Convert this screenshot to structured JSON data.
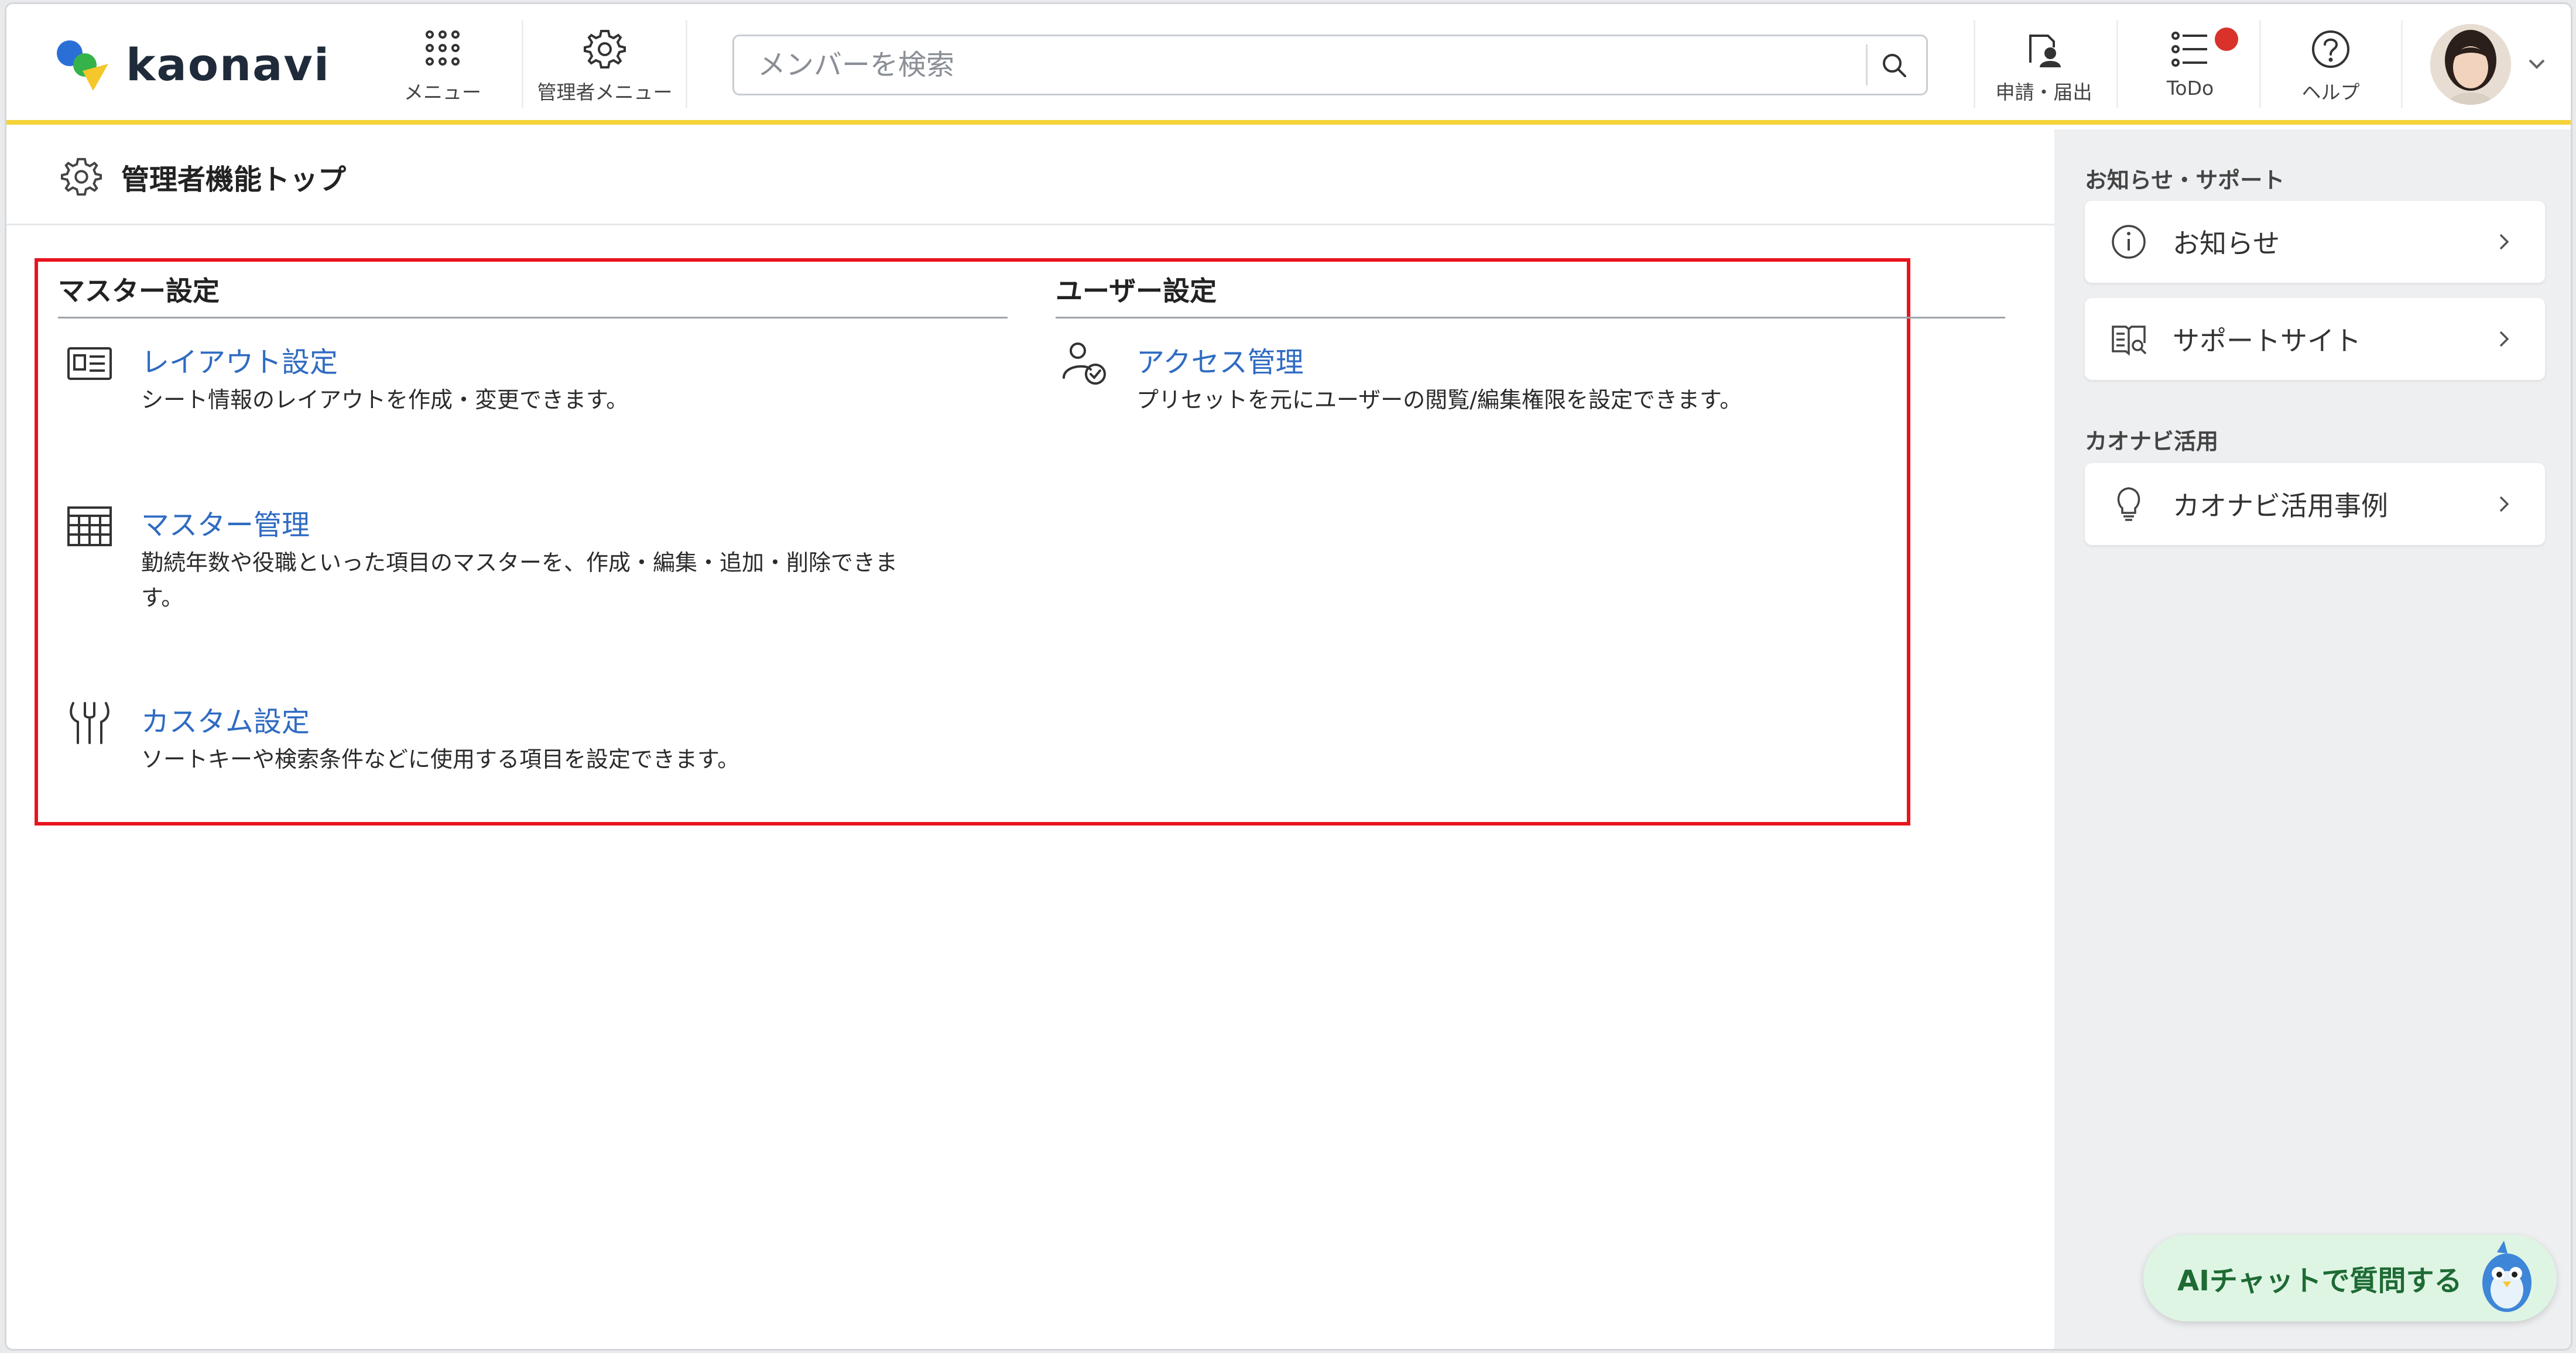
{
  "header": {
    "logo_text": "kaonavi",
    "nav": {
      "menu_label": "メニュー",
      "admin_menu_label": "管理者メニュー"
    },
    "search": {
      "placeholder": "メンバーを検索"
    },
    "actions": {
      "requests_label": "申請・届出",
      "todo_label": "ToDo",
      "help_label": "ヘルプ"
    },
    "colors": {
      "accent_bar": "#f4d33a",
      "notification_dot": "#d8322b"
    }
  },
  "main": {
    "page_title": "管理者機能トップ",
    "sections": {
      "master": {
        "heading": "マスター設定",
        "items": [
          {
            "icon": "layout-card-icon",
            "label": "レイアウト設定",
            "desc": "シート情報のレイアウトを作成・変更できます。"
          },
          {
            "icon": "table-grid-icon",
            "label": "マスター管理",
            "desc_line1": "勤続年数や役職といった項目のマスターを、作成・編集・追加・削除できま",
            "desc_line2": "す。"
          },
          {
            "icon": "custom-tools-icon",
            "label": "カスタム設定",
            "desc": "ソートキーや検索条件などに使用する項目を設定できます。"
          }
        ]
      },
      "user": {
        "heading": "ユーザー設定",
        "items": [
          {
            "icon": "user-check-icon",
            "label": "アクセス管理",
            "desc": "プリセットを元にユーザーの閲覧/編集権限を設定できます。"
          }
        ]
      }
    },
    "link_color": "#2f6bc2",
    "highlight_color": "#e8141d"
  },
  "sidebar": {
    "news_heading": "お知らせ・サポート",
    "news_items": [
      {
        "icon": "info-icon",
        "label": "お知らせ"
      },
      {
        "icon": "book-search-icon",
        "label": "サポートサイト"
      }
    ],
    "usage_heading": "カオナビ活用",
    "usage_items": [
      {
        "icon": "lightbulb-icon",
        "label": "カオナビ活用事例"
      }
    ]
  },
  "ai_chat": {
    "label": "AIチャットで質問する"
  }
}
